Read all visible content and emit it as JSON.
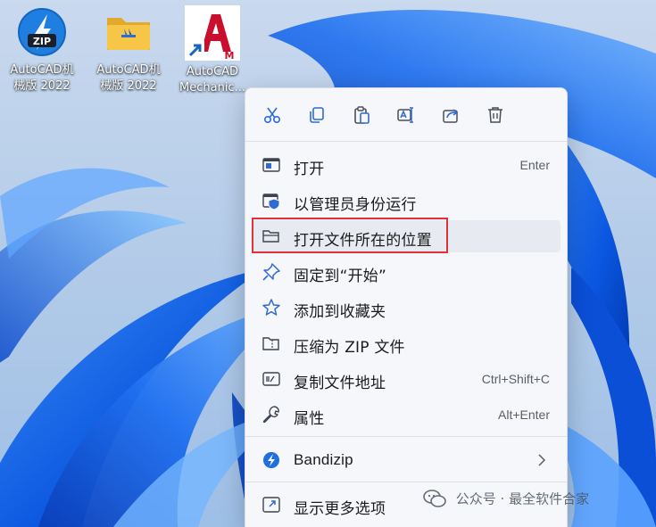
{
  "desktop": {
    "icons": [
      {
        "name": "autocad-zip-icon",
        "line1": "AutoCAD机",
        "line2": "械版 2022"
      },
      {
        "name": "autocad-folder-icon",
        "line1": "AutoCAD机",
        "line2": "械版 2022"
      },
      {
        "name": "autocad-mechanical-shortcut",
        "line1": "AutoCAD",
        "line2": "Mechanic..."
      }
    ],
    "zip_badge": "ZIP",
    "shortcut_badge": "M"
  },
  "menu": {
    "toolbar": [
      "cut-icon",
      "copy-icon",
      "paste-icon",
      "rename-icon",
      "share-icon",
      "delete-icon"
    ],
    "items": [
      {
        "label": "打开",
        "shortcut": "Enter",
        "icon": "open-window-icon"
      },
      {
        "label": "以管理员身份运行",
        "shortcut": "",
        "icon": "admin-shield-icon"
      },
      {
        "label": "打开文件所在的位置",
        "shortcut": "",
        "icon": "folder-icon"
      },
      {
        "label": "固定到“开始”",
        "shortcut": "",
        "icon": "pin-icon"
      },
      {
        "label": "添加到收藏夹",
        "shortcut": "",
        "icon": "star-icon"
      },
      {
        "label": "压缩为 ZIP 文件",
        "shortcut": "",
        "icon": "zip-folder-icon"
      },
      {
        "label": "复制文件地址",
        "shortcut": "Ctrl+Shift+C",
        "icon": "copy-path-icon"
      },
      {
        "label": "属性",
        "shortcut": "Alt+Enter",
        "icon": "wrench-icon"
      },
      {
        "label": "Bandizip",
        "shortcut": "",
        "icon": "bandizip-icon"
      },
      {
        "label": "显示更多选项",
        "shortcut": "",
        "icon": "more-options-icon"
      }
    ]
  },
  "watermark": {
    "text": "公众号 · 最全软件合家"
  },
  "colors": {
    "accent": "#0067c0",
    "highlight_border": "#e0323c",
    "autocad_red": "#c8102e"
  }
}
